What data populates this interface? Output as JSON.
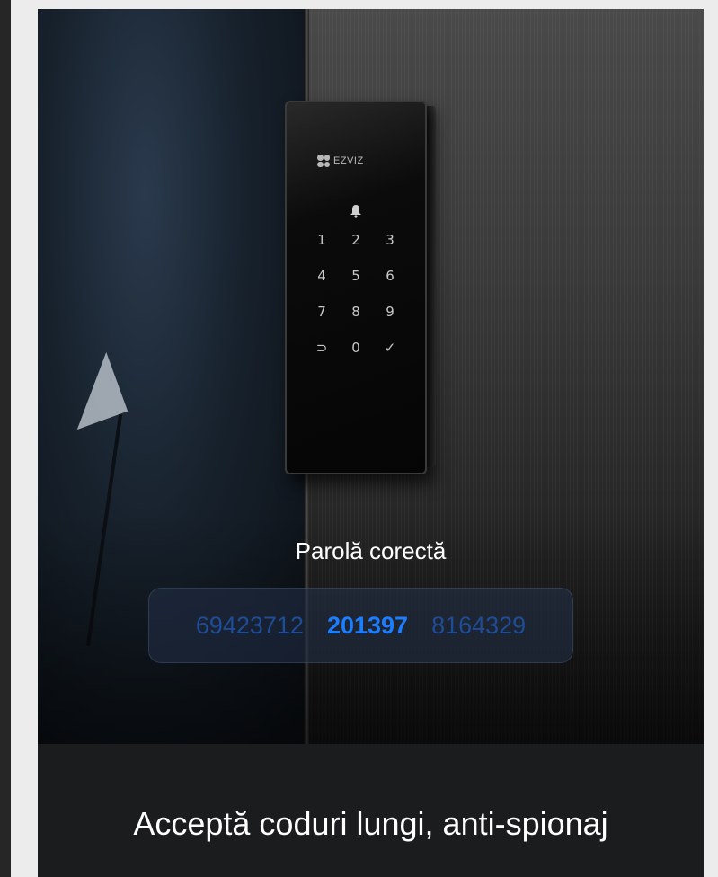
{
  "keypad": {
    "brand": "EZVIZ",
    "keys": [
      "1",
      "2",
      "3",
      "4",
      "5",
      "6",
      "7",
      "8",
      "9",
      "⊃",
      "0",
      "✓"
    ]
  },
  "caption": "Parolă corectă",
  "code": {
    "left": "69423712",
    "middle": "201397",
    "right": "8164329"
  },
  "footer_title": "Acceptă coduri lungi, anti-spionaj",
  "colors": {
    "code_dim": "#1f4c96",
    "code_bright": "#1c7dff",
    "band": "#1b1c1e"
  }
}
